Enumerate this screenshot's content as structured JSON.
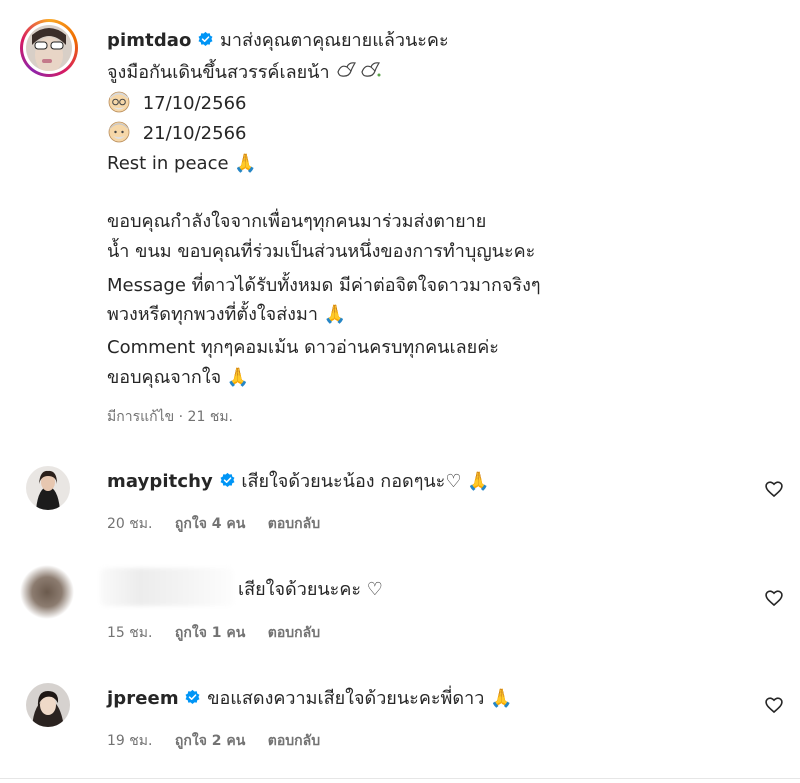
{
  "post": {
    "username": "pimtdao",
    "line1": "มาส่งคุณตาคุณยายแล้วนะคะ",
    "line2": "จูงมือกันเดินขึ้นสวรรค์เลยน้า",
    "line2_emoji": "🕊🕊",
    "date1": "17/10/2566",
    "date2": "21/10/2566",
    "rip": "Rest in peace",
    "pray": "🙏",
    "para": [
      "ขอบคุณกำลังใจจากเพื่อนๆทุกคนมาร่วมส่งตายาย",
      "น้ำ ขนม ขอบคุณที่ร่วมเป็นส่วนหนึ่งของการทำบุญนะคะ",
      "Message ที่ดาวได้รับทั้งหมด มีค่าต่อจิตใจดาวมากจริงๆ",
      "พวงหรีดทุกพวงที่ตั้งใจส่งมา",
      "Comment ทุกๆคอมเม้น ดาวอ่านครบทุกคนเลยค่ะ",
      "ขอบคุณจากใจ"
    ],
    "meta": "มีการแก้ไข · 21 ชม."
  },
  "comments": [
    {
      "username": "maypitchy",
      "text": "เสียใจด้วยนะน้อง กอดๆนะ♡",
      "pray": "🙏",
      "time": "20 ชม.",
      "likes": "ถูกใจ 4 คน",
      "reply": "ตอบกลับ"
    },
    {
      "username": "",
      "text": "เสียใจด้วยนะคะ ♡",
      "time": "15 ชม.",
      "likes": "ถูกใจ 1 คน",
      "reply": "ตอบกลับ"
    },
    {
      "username": "jpreem",
      "text": "ขอแสดงความเสียใจด้วยนะคะพี่ดาว",
      "pray": "🙏",
      "time": "19 ชม.",
      "likes": "ถูกใจ 2 คน",
      "reply": "ตอบกลับ"
    }
  ],
  "colors": {
    "verified": "#0095f6",
    "meta": "#737373",
    "text": "#262626"
  },
  "icons": [
    "verified-badge-icon",
    "heart-icon",
    "dove-icon",
    "old-man-face-icon",
    "praying-hands-icon"
  ]
}
